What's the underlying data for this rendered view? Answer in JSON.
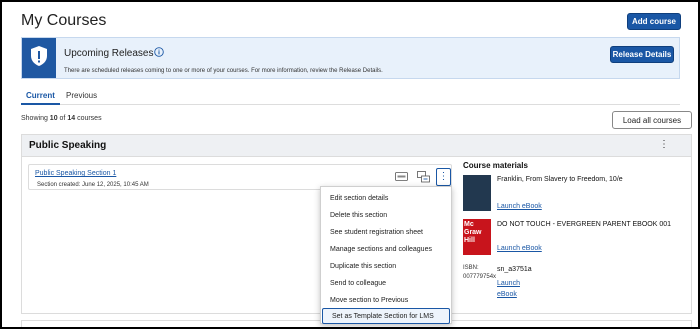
{
  "header": {
    "title": "My Courses",
    "add_course_label": "Add course"
  },
  "banner": {
    "title": "Upcoming Releases",
    "text": "There are scheduled releases coming to one or more of your courses. For more information, review the Release Details.",
    "release_details_label": "Release Details"
  },
  "tabs": [
    {
      "label": "Current"
    },
    {
      "label": "Previous"
    }
  ],
  "showing": {
    "prefix": "Showing ",
    "shown": "10",
    "mid": " of ",
    "total": "14",
    "suffix": " courses"
  },
  "load_all_label": "Load all courses",
  "course": {
    "title": "Public Speaking",
    "kebab": "⋮",
    "section": {
      "link": "Public Speaking Section 1",
      "created": "Section created: June 12, 2025, 10:45 AM",
      "kebab": "⋮"
    },
    "materials": {
      "title": "Course materials",
      "items": [
        {
          "title": "Franklin, From Slavery to Freedom, 10/e",
          "link": "Launch eBook"
        },
        {
          "title": "DO NOT TOUCH - EVERGREEN PARENT EBOOK 001",
          "link": "Launch eBook",
          "cover_text": "Mc Graw Hill"
        },
        {
          "title": "sn_a3751a",
          "link_line1": "Launch",
          "link_line2": "eBook",
          "cover_alt": "ISBN: 007779754x"
        }
      ]
    }
  },
  "menu": {
    "items": [
      "Edit section details",
      "Delete this section",
      "See student registration sheet",
      "Manage sections and colleagues",
      "Duplicate this section",
      "Send to colleague",
      "Move section to Previous",
      "Set as Template Section for LMS"
    ],
    "selected_index": 7
  },
  "colors": {
    "primary": "#1a57a5",
    "banner_bg": "#e8f1fb",
    "card_header_bg": "#eef0f3"
  }
}
